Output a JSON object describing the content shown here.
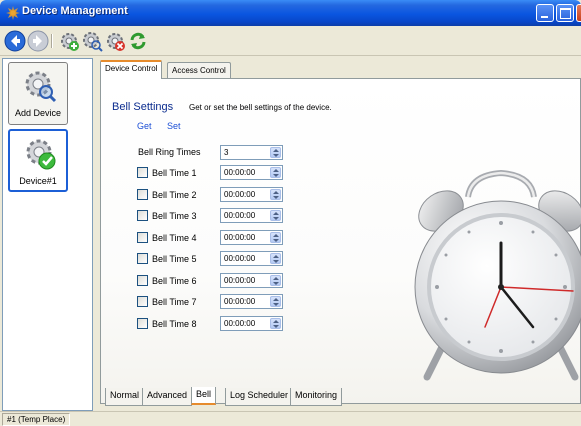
{
  "window": {
    "title": "Device Management"
  },
  "toolbar": {
    "buttons": [
      "back-icon",
      "forward-icon",
      "add-device-icon",
      "search-device-icon",
      "remove-device-icon",
      "refresh-icon"
    ]
  },
  "devices": {
    "add_label": "Add Device",
    "items": [
      {
        "label": "Device#1"
      }
    ]
  },
  "top_tabs": {
    "device_control": "Device Control",
    "access_control": "Access Control"
  },
  "bell": {
    "title": "Bell Settings",
    "description": "Get or set the bell settings of the device.",
    "get_label": "Get",
    "set_label": "Set",
    "ring_times_label": "Bell Ring Times",
    "ring_times_value": "3",
    "times": [
      {
        "label": "Bell Time 1",
        "value": "00:00:00"
      },
      {
        "label": "Bell Time 2",
        "value": "00:00:00"
      },
      {
        "label": "Bell Time 3",
        "value": "00:00:00"
      },
      {
        "label": "Bell Time 4",
        "value": "00:00:00"
      },
      {
        "label": "Bell Time 5",
        "value": "00:00:00"
      },
      {
        "label": "Bell Time 6",
        "value": "00:00:00"
      },
      {
        "label": "Bell Time 7",
        "value": "00:00:00"
      },
      {
        "label": "Bell Time 8",
        "value": "00:00:00"
      }
    ]
  },
  "bottom_tabs": {
    "normal": "Normal",
    "advanced": "Advanced",
    "bell": "Bell",
    "log_scheduler": "Log Scheduler",
    "monitoring": "Monitoring"
  },
  "status": {
    "panel": "#1 (Temp Place)"
  },
  "colors": {
    "title_bar": "#0a55e0",
    "accent_tab": "#e68b2c",
    "link": "#1c4fd6",
    "heading": "#0b2c8e"
  }
}
